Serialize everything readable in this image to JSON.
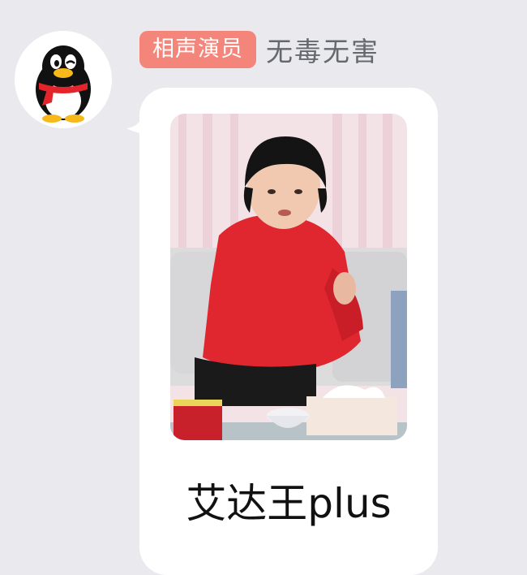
{
  "sender": {
    "badge": "相声演员",
    "nickname": "无毒无害",
    "avatar_icon": "qq-penguin-avatar-icon"
  },
  "message": {
    "caption": "艾达王plus",
    "image_description_icon": "photo-woman-red-sweater-on-sofa"
  },
  "colors": {
    "background": "#e9e9ee",
    "badge": "#f4857a",
    "bubble": "#ffffff",
    "nickname": "#666870"
  }
}
